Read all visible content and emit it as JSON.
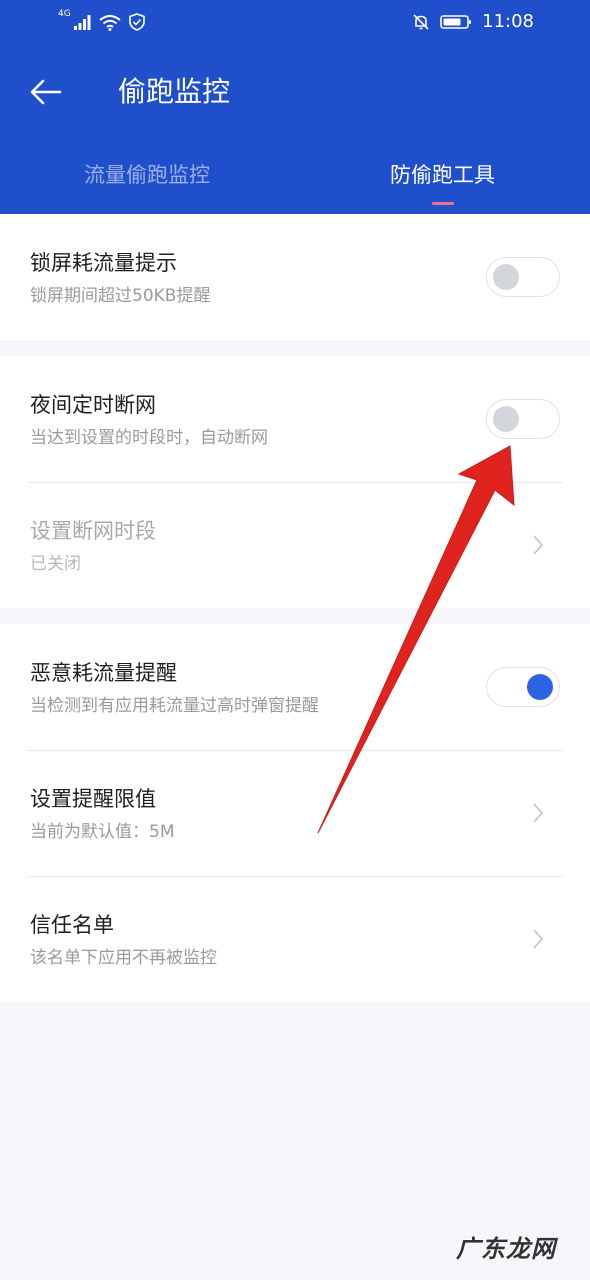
{
  "status_bar": {
    "network": "4G",
    "time": "11:08",
    "icons": [
      "signal-icon",
      "wifi-icon",
      "shield-icon",
      "bell-off-icon",
      "battery-icon"
    ]
  },
  "app_bar": {
    "title": "偷跑监控",
    "back_icon": "arrow-left-icon"
  },
  "tabs": [
    {
      "label": "流量偷跑监控",
      "active": false
    },
    {
      "label": "防偷跑工具",
      "active": true
    }
  ],
  "settings": {
    "lock_screen": {
      "title": "锁屏耗流量提示",
      "subtitle": "锁屏期间超过50KB提醒",
      "enabled": false
    },
    "night_cutoff": {
      "title": "夜间定时断网",
      "subtitle": "当达到设置的时段时，自动断网",
      "enabled": false
    },
    "cutoff_period": {
      "title": "设置断网时段",
      "subtitle": "已关闭"
    },
    "malicious_alert": {
      "title": "恶意耗流量提醒",
      "subtitle": "当检测到有应用耗流量过高时弹窗提醒",
      "enabled": true
    },
    "alert_threshold": {
      "title": "设置提醒限值",
      "subtitle": "当前为默认值：5M"
    },
    "trust_list": {
      "title": "信任名单",
      "subtitle": "该名单下应用不再被监控"
    }
  },
  "colors": {
    "header": "#1f4fcb",
    "switch_on": "#2b63e4",
    "tab_indicator": "#f06f8d",
    "annotation_arrow": "#e0231e"
  },
  "watermark": "广东龙网"
}
